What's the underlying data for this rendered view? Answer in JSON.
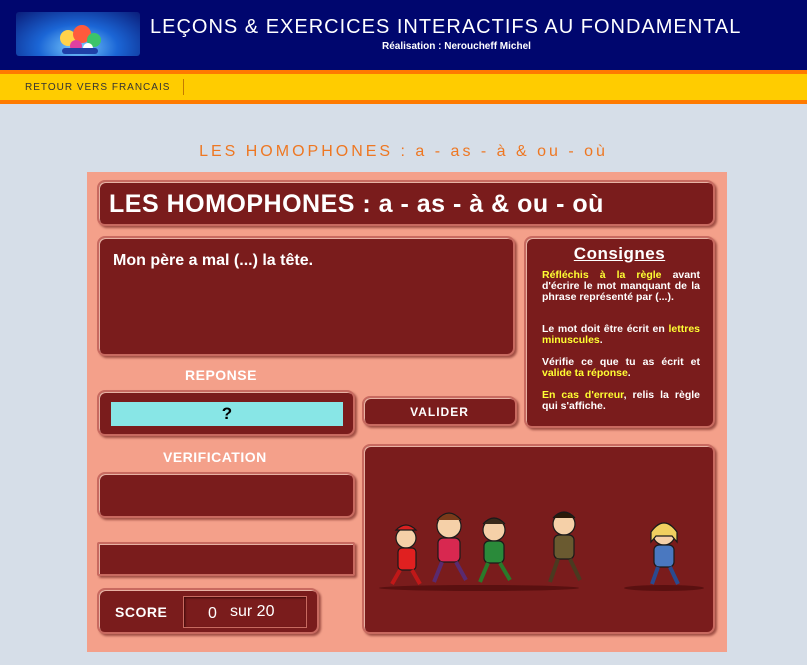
{
  "header": {
    "title": "LEÇONS & EXERCICES INTERACTIFS AU FONDAMENTAL",
    "author": "Réalisation : Neroucheff Michel"
  },
  "nav": {
    "back_link": "RETOUR VERS FRANCAIS"
  },
  "page": {
    "heading": "LES HOMOPHONES : a - as - à & ou - où"
  },
  "exercise": {
    "title": "LES HOMOPHONES : a - as - à & ou - où",
    "question": "Mon père a mal (...) la tête.",
    "reponse_label": "REPONSE",
    "answer_value": "?",
    "validate_label": "VALIDER",
    "verification_label": "VERIFICATION",
    "score_label": "SCORE",
    "score_value": "0",
    "score_total": "sur 20"
  },
  "consignes": {
    "title": "Consignes",
    "p1_hl": "Réfléchis à la règle",
    "p1_rest": "avant d'écrire le mot manquant de la phrase représenté par (...).",
    "p2_start": "Le mot doit être écrit en",
    "p2_hl": "lettres minuscules",
    "p2_end": ".",
    "p3_start": "Vérifie ce que tu as écrit et",
    "p3_hl": "valide ta réponse",
    "p3_end": ".",
    "p4_hl": "En cas d'erreur",
    "p4_rest": ", relis la règle qui s'affiche."
  },
  "colors": {
    "header_bg": "#00066e",
    "nav_bg": "#ffcc00",
    "accent_orange": "#ee7722",
    "panel_bg": "#f4a08a",
    "box_bg": "#7a1c1c",
    "answer_bg": "#88e6e6",
    "highlight": "#ffff33"
  }
}
